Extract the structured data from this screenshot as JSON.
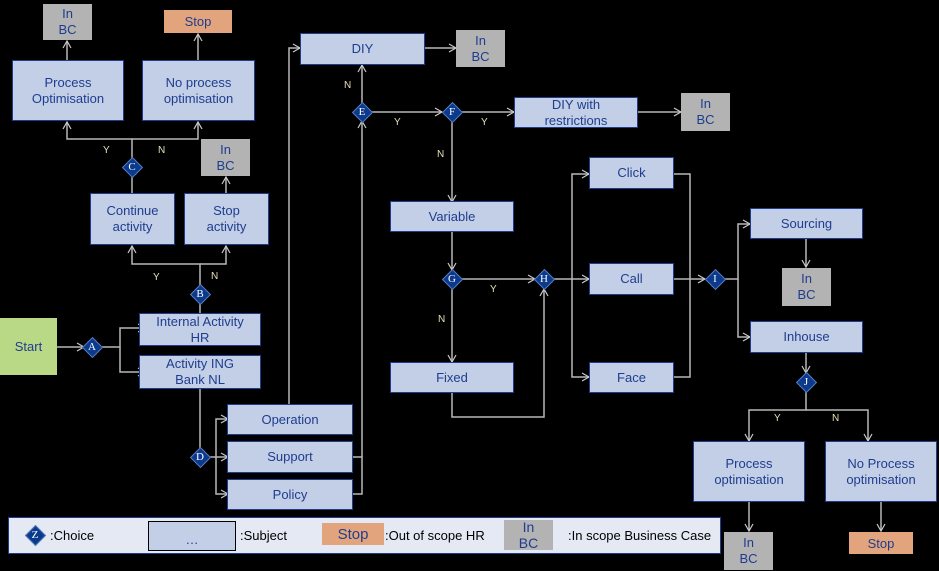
{
  "colors": {
    "subject_fill": "#c3cfe6",
    "subject_border": "#1f3d8f",
    "in_bc_fill": "#b3b3b3",
    "stop_fill": "#e2a47d",
    "start_fill": "#b9d987",
    "choice_fill": "#0b3a8c",
    "connector": "#c0c0c0",
    "background": "#000000"
  },
  "nodes": {
    "start": "Start",
    "internal_activity_hr": "Internal  Activity\nHR",
    "activity_ing_bank_nl": "Activity ING\nBank NL",
    "continue_activity": "Continue\nactivity",
    "stop_activity": "Stop\nactivity",
    "process_optimisation_top": "Process\nOptimisation",
    "no_process_optimisation_top": "No process\noptimisation",
    "operation": "Operation",
    "support": "Support",
    "policy": "Policy",
    "diy": "DIY",
    "diy_with_restrictions": "DIY with\nrestrictions",
    "variable": "Variable",
    "fixed": "Fixed",
    "click": "Click",
    "call": "Call",
    "face": "Face",
    "sourcing": "Sourcing",
    "inhouse": "Inhouse",
    "process_optimisation_bottom": "Process\noptimisation",
    "no_process_optimisation_bottom": "No Process\noptimisation",
    "in_bc": "In\nBC",
    "stop": "Stop"
  },
  "choices": [
    "A",
    "B",
    "C",
    "D",
    "E",
    "F",
    "G",
    "H",
    "I",
    "J"
  ],
  "branch_labels": {
    "yes": "Y",
    "no": "N"
  },
  "legend": {
    "choice_symbol": "Z",
    "choice_label": ":Choice",
    "subject_symbol": "…",
    "subject_label": ":Subject",
    "stop_symbol": "Stop",
    "stop_label": ":Out of scope HR",
    "inbc_symbol": "In\nBC",
    "inbc_label": ":In scope Business Case"
  }
}
